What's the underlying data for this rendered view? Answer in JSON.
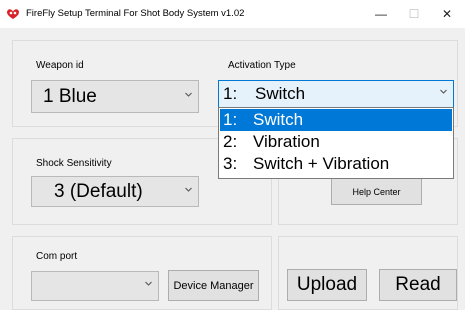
{
  "window": {
    "title": "FireFly Setup Terminal For Shot Body System  v1.02",
    "minimize_glyph": "—",
    "maximize_glyph": "☐",
    "close_glyph": "✕",
    "icon": "firefly-logo-icon",
    "accent_color": "#d9232a"
  },
  "weapon": {
    "label": "Weapon id",
    "value": "1 Blue"
  },
  "activation": {
    "label": "Activation Type",
    "selected_number": "1:",
    "selected_text": "Switch",
    "options": [
      {
        "number": "1:",
        "text": "Switch",
        "highlighted": true
      },
      {
        "number": "2:",
        "text": "Vibration",
        "highlighted": false
      },
      {
        "number": "3:",
        "text": "Switch + Vibration",
        "highlighted": false
      }
    ],
    "highlight_color": "#0078d7"
  },
  "shock": {
    "label": "Shock Sensitivity",
    "value": "3 (Default)"
  },
  "help": {
    "button_label": "Help Center"
  },
  "comport": {
    "label": "Com port",
    "value": "",
    "device_manager_label": "Device Manager"
  },
  "actions": {
    "upload_label": "Upload",
    "read_label": "Read"
  }
}
